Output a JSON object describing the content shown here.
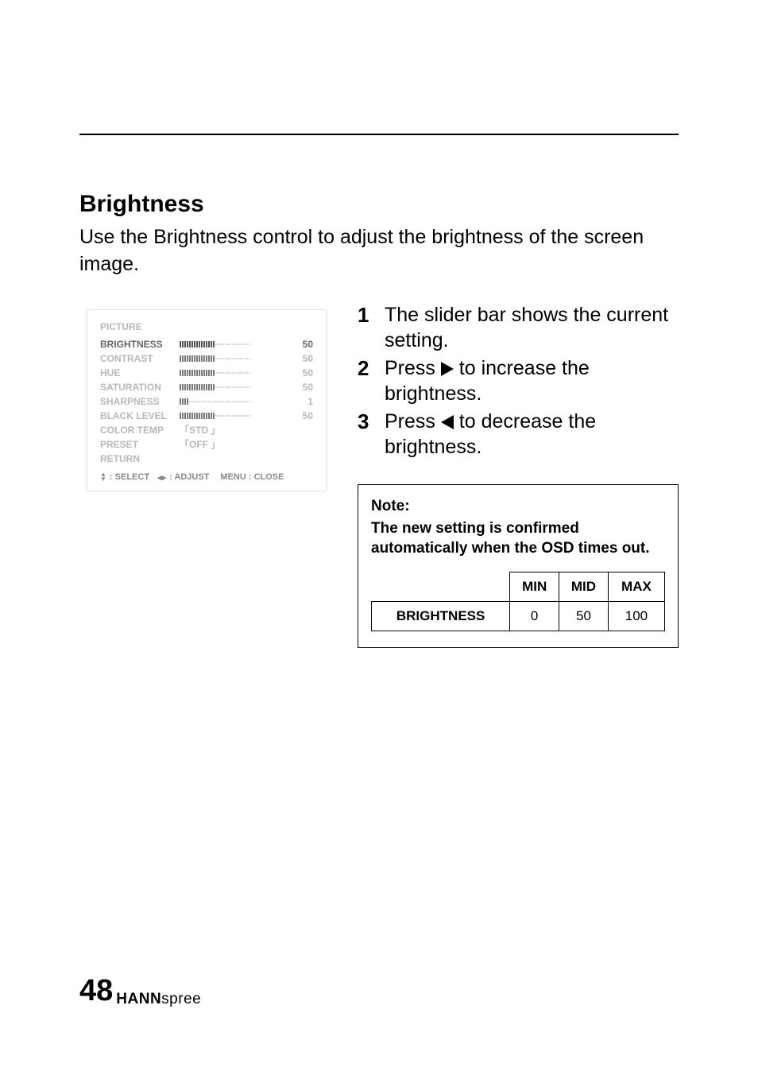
{
  "section": {
    "title": "Brightness",
    "lead": "Use the Brightness control to adjust the brightness of the screen image."
  },
  "osd": {
    "menu_title": "PICTURE",
    "items": [
      {
        "label": "BRIGHTNESS",
        "value": "50",
        "fill_pct": 50,
        "active": true,
        "type": "bar"
      },
      {
        "label": "CONTRAST",
        "value": "50",
        "fill_pct": 50,
        "active": false,
        "type": "bar"
      },
      {
        "label": "HUE",
        "value": "50",
        "fill_pct": 50,
        "active": false,
        "type": "bar"
      },
      {
        "label": "SATURATION",
        "value": "50",
        "fill_pct": 50,
        "active": false,
        "type": "bar"
      },
      {
        "label": "SHARPNESS",
        "value": "1",
        "fill_pct": 12,
        "active": false,
        "type": "bar"
      },
      {
        "label": "BLACK LEVEL",
        "value": "50",
        "fill_pct": 50,
        "active": false,
        "type": "bar"
      },
      {
        "label": "COLOR TEMP",
        "text": "「STD 」",
        "active": false,
        "type": "text"
      },
      {
        "label": "PRESET",
        "text": "「OFF 」",
        "active": false,
        "type": "text"
      },
      {
        "label": "RETURN",
        "active": false,
        "type": "none"
      }
    ],
    "footer": {
      "select": ": SELECT",
      "adjust": ": ADJUST",
      "close": "MENU : CLOSE"
    }
  },
  "steps": [
    {
      "n": "1",
      "before": "The slider bar shows the current setting.",
      "arrow": "",
      "after": ""
    },
    {
      "n": "2",
      "before": "Press ",
      "arrow": "right",
      "after": " to increase the brightness."
    },
    {
      "n": "3",
      "before": "Press ",
      "arrow": "left",
      "after": " to decrease the brightness."
    }
  ],
  "note": {
    "label": "Note:",
    "text": "The new setting is confirmed automatically when the OSD times out.",
    "table": {
      "headers": [
        "MIN",
        "MID",
        "MAX"
      ],
      "row_label": "BRIGHTNESS",
      "values": [
        "0",
        "50",
        "100"
      ]
    }
  },
  "footer": {
    "page": "48",
    "brand_bold": "HANN",
    "brand_light": "spree"
  }
}
